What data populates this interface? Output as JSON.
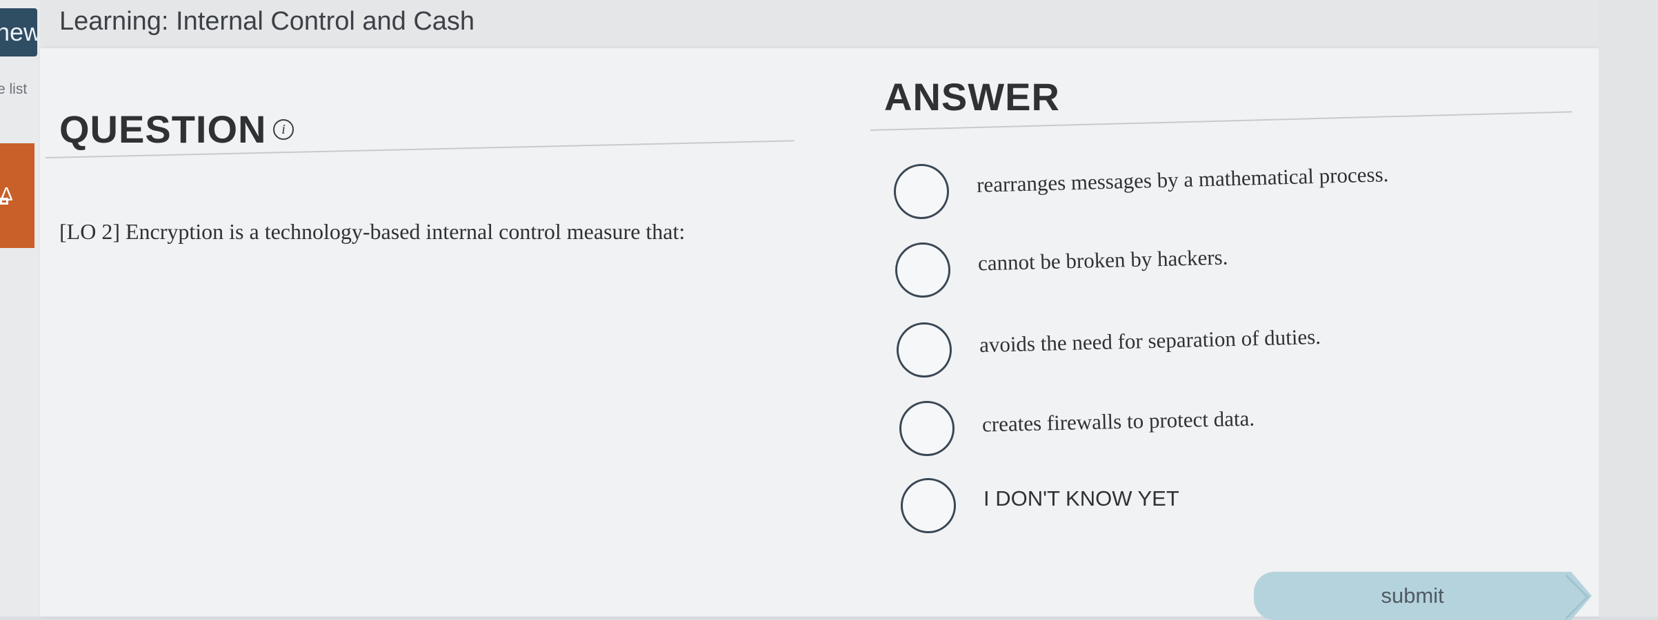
{
  "header": {
    "title": "Learning: Internal Control and Cash"
  },
  "left_rail": {
    "new_tab_label": "new",
    "list_label": "e list"
  },
  "question": {
    "heading": "QUESTION",
    "info_icon": "info-icon",
    "text": "[LO 2] Encryption is a technology-based internal control measure that:"
  },
  "answer": {
    "heading": "ANSWER",
    "options": [
      {
        "label": "rearranges messages by a mathematical process."
      },
      {
        "label": "cannot be broken by hackers."
      },
      {
        "label": "avoids the need for separation of duties."
      },
      {
        "label": "creates firewalls to protect data."
      },
      {
        "label": "I DON'T KNOW YET"
      }
    ]
  },
  "submit_label": "submit",
  "colors": {
    "submit_bg": "#b5d3dd",
    "radio_border": "#3a4754",
    "rail_accent_orange": "#c9602a",
    "rail_accent_navy": "#2f4d63"
  }
}
